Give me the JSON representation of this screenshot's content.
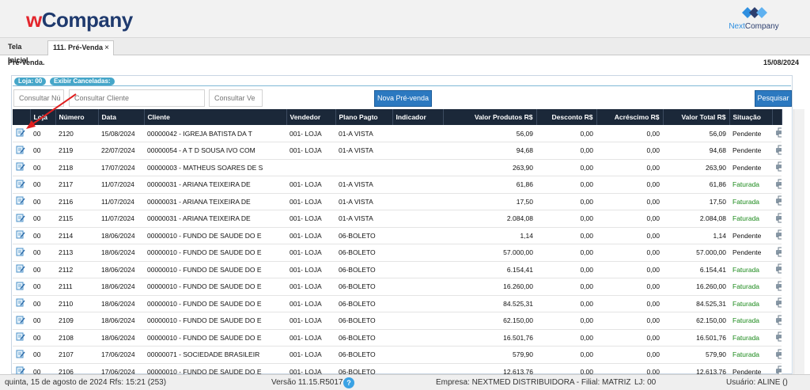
{
  "header": {
    "logo_w": "w",
    "logo_rest": "Company",
    "partner_logo_a": "Next",
    "partner_logo_b": "Company"
  },
  "tabs": [
    {
      "label": "Tela Inicial"
    },
    {
      "label": "111. Pré-Venda",
      "close": "×"
    }
  ],
  "page": {
    "title": "Pré-Venda.",
    "date": "15/08/2024"
  },
  "badges": {
    "loja": "Loja: 00",
    "canceladas": "Exibir Canceladas:"
  },
  "filters": {
    "numero_placeholder": "Consultar Nú",
    "cliente_placeholder": "Consultar Cliente",
    "vendedor_placeholder": "Consultar Ve",
    "nova_label": "Nova Pré-venda",
    "pesquisar_label": "Pesquisar"
  },
  "table": {
    "columns": [
      "",
      "Loja",
      "Número",
      "Data",
      "Cliente",
      "Vendedor",
      "Plano Pagto",
      "Indicador",
      "Valor Produtos R$",
      "Desconto R$",
      "Acréscimo R$",
      "Valor Total R$",
      "Situação",
      ""
    ],
    "rows": [
      {
        "loja": "00",
        "numero": "2120",
        "data": "15/08/2024",
        "cliente": "00000042 - IGREJA BATISTA DA T",
        "vendedor": "001- LOJA",
        "plano": "01-A VISTA",
        "indicador": "",
        "produtos": "56,09",
        "desconto": "0,00",
        "acrescimo": "0,00",
        "total": "56,09",
        "situacao": "Pendente"
      },
      {
        "loja": "00",
        "numero": "2119",
        "data": "22/07/2024",
        "cliente": "00000054 - A T D SOUSA IVO COM",
        "vendedor": "001- LOJA",
        "plano": "01-A VISTA",
        "indicador": "",
        "produtos": "94,68",
        "desconto": "0,00",
        "acrescimo": "0,00",
        "total": "94,68",
        "situacao": "Pendente"
      },
      {
        "loja": "00",
        "numero": "2118",
        "data": "17/07/2024",
        "cliente": "00000003 - MATHEUS SOARES DE S",
        "vendedor": "",
        "plano": "",
        "indicador": "",
        "produtos": "263,90",
        "desconto": "0,00",
        "acrescimo": "0,00",
        "total": "263,90",
        "situacao": "Pendente"
      },
      {
        "loja": "00",
        "numero": "2117",
        "data": "11/07/2024",
        "cliente": "00000031 - ARIANA TEIXEIRA DE",
        "vendedor": "001- LOJA",
        "plano": "01-A VISTA",
        "indicador": "",
        "produtos": "61,86",
        "desconto": "0,00",
        "acrescimo": "0,00",
        "total": "61,86",
        "situacao": "Faturada"
      },
      {
        "loja": "00",
        "numero": "2116",
        "data": "11/07/2024",
        "cliente": "00000031 - ARIANA TEIXEIRA DE",
        "vendedor": "001- LOJA",
        "plano": "01-A VISTA",
        "indicador": "",
        "produtos": "17,50",
        "desconto": "0,00",
        "acrescimo": "0,00",
        "total": "17,50",
        "situacao": "Faturada"
      },
      {
        "loja": "00",
        "numero": "2115",
        "data": "11/07/2024",
        "cliente": "00000031 - ARIANA TEIXEIRA DE",
        "vendedor": "001- LOJA",
        "plano": "01-A VISTA",
        "indicador": "",
        "produtos": "2.084,08",
        "desconto": "0,00",
        "acrescimo": "0,00",
        "total": "2.084,08",
        "situacao": "Faturada"
      },
      {
        "loja": "00",
        "numero": "2114",
        "data": "18/06/2024",
        "cliente": "00000010 - FUNDO DE SAUDE DO E",
        "vendedor": "001- LOJA",
        "plano": "06-BOLETO",
        "indicador": "",
        "produtos": "1,14",
        "desconto": "0,00",
        "acrescimo": "0,00",
        "total": "1,14",
        "situacao": "Pendente"
      },
      {
        "loja": "00",
        "numero": "2113",
        "data": "18/06/2024",
        "cliente": "00000010 - FUNDO DE SAUDE DO E",
        "vendedor": "001- LOJA",
        "plano": "06-BOLETO",
        "indicador": "",
        "produtos": "57.000,00",
        "desconto": "0,00",
        "acrescimo": "0,00",
        "total": "57.000,00",
        "situacao": "Pendente"
      },
      {
        "loja": "00",
        "numero": "2112",
        "data": "18/06/2024",
        "cliente": "00000010 - FUNDO DE SAUDE DO E",
        "vendedor": "001- LOJA",
        "plano": "06-BOLETO",
        "indicador": "",
        "produtos": "6.154,41",
        "desconto": "0,00",
        "acrescimo": "0,00",
        "total": "6.154,41",
        "situacao": "Faturada"
      },
      {
        "loja": "00",
        "numero": "2111",
        "data": "18/06/2024",
        "cliente": "00000010 - FUNDO DE SAUDE DO E",
        "vendedor": "001- LOJA",
        "plano": "06-BOLETO",
        "indicador": "",
        "produtos": "16.260,00",
        "desconto": "0,00",
        "acrescimo": "0,00",
        "total": "16.260,00",
        "situacao": "Faturada"
      },
      {
        "loja": "00",
        "numero": "2110",
        "data": "18/06/2024",
        "cliente": "00000010 - FUNDO DE SAUDE DO E",
        "vendedor": "001- LOJA",
        "plano": "06-BOLETO",
        "indicador": "",
        "produtos": "84.525,31",
        "desconto": "0,00",
        "acrescimo": "0,00",
        "total": "84.525,31",
        "situacao": "Faturada"
      },
      {
        "loja": "00",
        "numero": "2109",
        "data": "18/06/2024",
        "cliente": "00000010 - FUNDO DE SAUDE DO E",
        "vendedor": "001- LOJA",
        "plano": "06-BOLETO",
        "indicador": "",
        "produtos": "62.150,00",
        "desconto": "0,00",
        "acrescimo": "0,00",
        "total": "62.150,00",
        "situacao": "Faturada"
      },
      {
        "loja": "00",
        "numero": "2108",
        "data": "18/06/2024",
        "cliente": "00000010 - FUNDO DE SAUDE DO E",
        "vendedor": "001- LOJA",
        "plano": "06-BOLETO",
        "indicador": "",
        "produtos": "16.501,76",
        "desconto": "0,00",
        "acrescimo": "0,00",
        "total": "16.501,76",
        "situacao": "Faturada"
      },
      {
        "loja": "00",
        "numero": "2107",
        "data": "17/06/2024",
        "cliente": "00000071 - SOCIEDADE BRASILEIR",
        "vendedor": "001- LOJA",
        "plano": "06-BOLETO",
        "indicador": "",
        "produtos": "579,90",
        "desconto": "0,00",
        "acrescimo": "0,00",
        "total": "579,90",
        "situacao": "Faturada"
      },
      {
        "loja": "00",
        "numero": "2106",
        "data": "17/06/2024",
        "cliente": "00000010 - FUNDO DE SAUDE DO E",
        "vendedor": "001- LOJA",
        "plano": "06-BOLETO",
        "indicador": "",
        "produtos": "12.613,76",
        "desconto": "0,00",
        "acrescimo": "0,00",
        "total": "12.613,76",
        "situacao": "Pendente"
      }
    ]
  },
  "status": {
    "datetime": "quinta, 15 de agosto de 2024  Rfs: 15:21 (253)",
    "version": "Versão 11.15.R5017",
    "help": "?",
    "empresa": "Empresa: NEXTMED DISTRIBUIDORA - Filial: MATRIZ",
    "lj": "LJ: 00",
    "usuario": "Usuário: ALINE ()"
  },
  "colors": {
    "header_bg": "#1b2839",
    "accent_blue": "#2c79c0",
    "badge": "#45a6c9",
    "faturada": "#1c8a1c",
    "arrow": "#e02020"
  },
  "icons": {
    "row_edit": "edit-document-icon",
    "row_print": "printer-icon",
    "help": "help-circle-icon",
    "partner_logo": "nextcompany-diamond-logo"
  }
}
